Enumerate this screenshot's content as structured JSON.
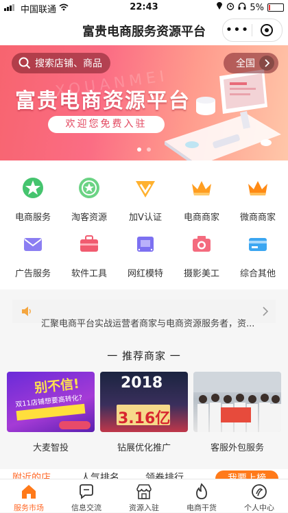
{
  "status_bar": {
    "carrier": "中国联通",
    "time": "22:43",
    "battery": "5%"
  },
  "nav": {
    "title": "富贵电商服务资源平台",
    "more": "•••"
  },
  "banner": {
    "search_placeholder": "搜索店铺、商品",
    "region": "全国",
    "headline": "富贵电商资源平台",
    "subline": "欢迎您免费入驻",
    "watermark": "XOUANMEI",
    "page_count": 2,
    "active_page": 0
  },
  "categories": [
    {
      "label": "电商服务",
      "icon": "star-badge-icon",
      "color": "#3fbf6a"
    },
    {
      "label": "淘客资源",
      "icon": "star-circle-icon",
      "color": "#63cf7d"
    },
    {
      "label": "加V认证",
      "icon": "v-badge-icon",
      "color": "#ffae2b"
    },
    {
      "label": "电商商家",
      "icon": "crown-icon",
      "color": "#ff9a1f"
    },
    {
      "label": "微商商家",
      "icon": "crown-icon",
      "color": "#ff8a14"
    },
    {
      "label": "广告服务",
      "icon": "envelope-icon",
      "color": "#8a7cf0"
    },
    {
      "label": "软件工具",
      "icon": "toolbox-icon",
      "color": "#f05a6e"
    },
    {
      "label": "网红模特",
      "icon": "film-icon",
      "color": "#7b6ff0"
    },
    {
      "label": "摄影美工",
      "icon": "camera-icon",
      "color": "#f46a7d"
    },
    {
      "label": "综合其他",
      "icon": "card-icon",
      "color": "#3aa3f0"
    }
  ],
  "notice": {
    "text": "汇聚电商平台实战运营者商家与电商资源服务者，资..."
  },
  "recommend": {
    "title": "一 推荐商家 一",
    "items": [
      {
        "label": "大麦智投",
        "img_text": "别不信!",
        "img_sub": "双11店铺想要高转化?"
      },
      {
        "label": "钻展优化推广",
        "img_text": "2018",
        "img_sub": "3.16亿"
      },
      {
        "label": "客服外包服务",
        "img_text": "",
        "img_sub": ""
      }
    ]
  },
  "list_tabs": {
    "tabs": [
      "附近的店",
      "人气排名",
      "领券排行"
    ],
    "button": "我要上榜"
  },
  "tabbar": {
    "items": [
      {
        "label": "服务市场",
        "icon": "home-icon"
      },
      {
        "label": "信息交流",
        "icon": "chat-icon"
      },
      {
        "label": "资源入驻",
        "icon": "store-icon"
      },
      {
        "label": "电商干货",
        "icon": "flame-icon"
      },
      {
        "label": "个人中心",
        "icon": "profile-icon"
      }
    ],
    "active": "服务市场"
  }
}
